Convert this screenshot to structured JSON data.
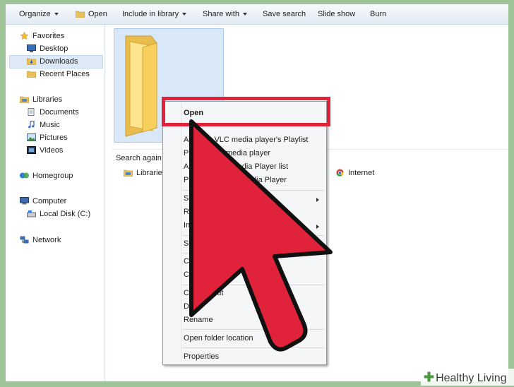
{
  "toolbar": {
    "organize": "Organize",
    "open": "Open",
    "include": "Include in library",
    "share": "Share with",
    "save_search": "Save search",
    "slide_show": "Slide show",
    "burn": "Burn"
  },
  "nav": {
    "favorites": "Favorites",
    "desktop": "Desktop",
    "downloads": "Downloads",
    "recent": "Recent Places",
    "libraries": "Libraries",
    "documents": "Documents",
    "music": "Music",
    "pictures": "Pictures",
    "videos": "Videos",
    "homegroup": "Homegroup",
    "computer": "Computer",
    "local_disk": "Local Disk (C:)",
    "network": "Network"
  },
  "content": {
    "search_again": "Search again in",
    "loc_libraries": "Libraries",
    "loc_internet": "Internet"
  },
  "menu": {
    "open": "Open",
    "vlc_playlist": "VLC media player's Playlist",
    "vlc_play": "LC media player",
    "wmp_list": "Media Player list",
    "wmp_play": "edia Player",
    "add_prefix_1": "Ad",
    "play_prefix_1": "Pla",
    "add_prefix_2": "Ad",
    "play_prefix_2": "Pla",
    "share": "Sha",
    "restore": "Res",
    "include": "Inc",
    "send": "Sen",
    "cut": "Cu",
    "copy": "Co",
    "create_prefix": "Cre",
    "create_suffix": "cut",
    "delete": "De",
    "rename": "Rename",
    "open_location": "Open folder location",
    "properties": "Properties"
  },
  "brand": {
    "name": "Healthy Living",
    "accent": "#e0233b",
    "green": "#4e9b42"
  }
}
